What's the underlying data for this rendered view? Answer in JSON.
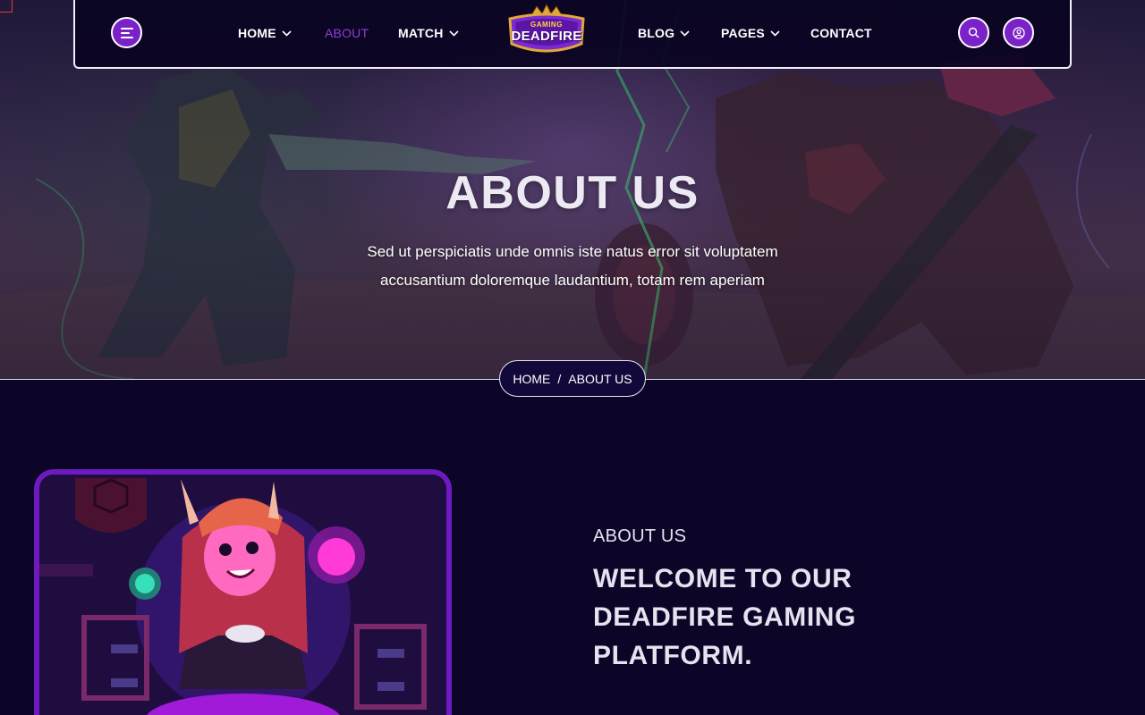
{
  "nav": {
    "items": [
      {
        "label": "HOME",
        "has_dropdown": true
      },
      {
        "label": "ABOUT",
        "has_dropdown": false,
        "active": true
      },
      {
        "label": "MATCH",
        "has_dropdown": true
      },
      {
        "label": "BLOG",
        "has_dropdown": true
      },
      {
        "label": "PAGES",
        "has_dropdown": true
      },
      {
        "label": "CONTACT",
        "has_dropdown": false
      }
    ],
    "logo": {
      "small": "GAMING",
      "big": "DEADFIRE"
    },
    "icons": {
      "menu": "hamburger-icon",
      "search": "search-icon",
      "user": "user-icon"
    }
  },
  "hero": {
    "title": "ABOUT US",
    "description_line1": "Sed ut perspiciatis unde omnis iste natus error sit voluptatem",
    "description_line2": "accusantium doloremque laudantium, totam rem aperiam"
  },
  "breadcrumb": {
    "home": "HOME",
    "separator": "/",
    "current": "ABOUT US"
  },
  "about": {
    "kicker": "ABOUT US",
    "heading": "WELCOME TO OUR DEADFIRE GAMING PLATFORM."
  },
  "colors": {
    "background": "#0c0527",
    "accent": "#7a22c8",
    "active_nav": "#8f3ed8",
    "frame": "#6d1bc0"
  }
}
